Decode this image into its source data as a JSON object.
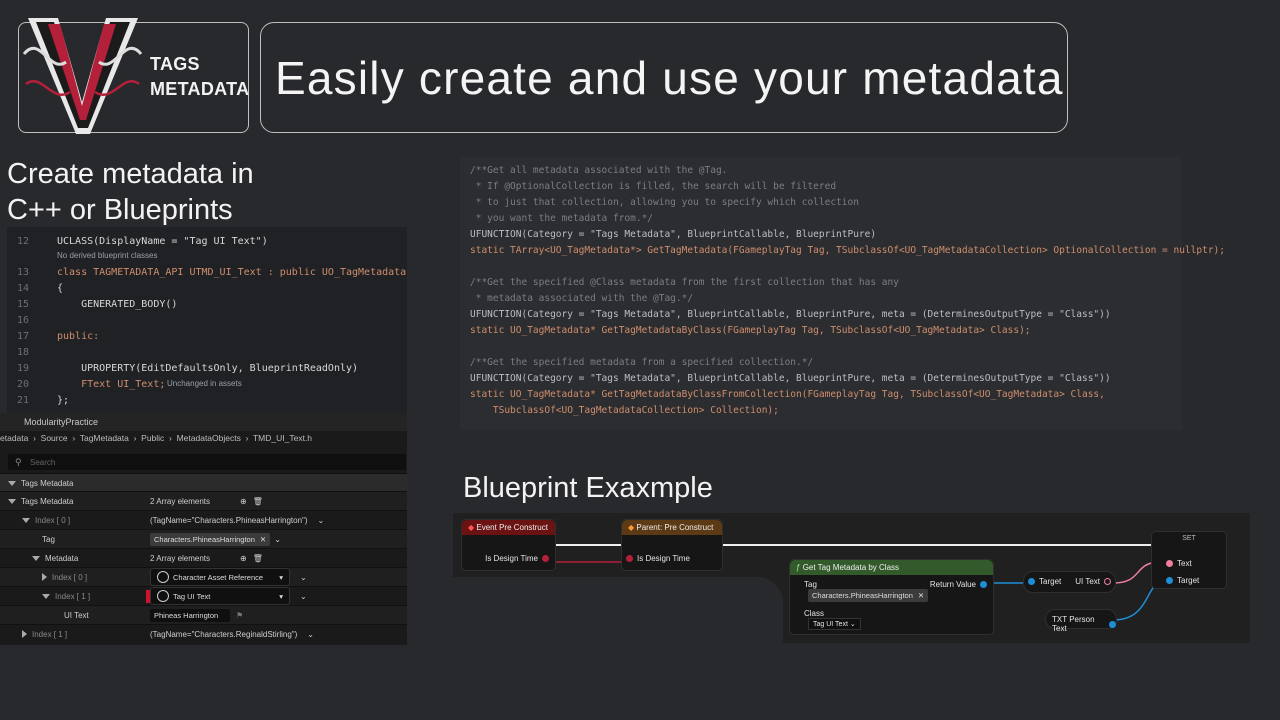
{
  "colors": {
    "background": "#28292d",
    "accent_red": "#b4203a",
    "code_bg": "#2b2d30"
  },
  "logo": {
    "line1": "TAGS",
    "line2": "METADATA",
    "icon": "tags-metadata-logo"
  },
  "title": "Easily create and use your metadata",
  "create_heading": {
    "line1": "Create metadata in",
    "line2": "C++ or Blueprints"
  },
  "ide": {
    "lines": [
      {
        "no": "12",
        "text": "UCLASS(DisplayName = \"Tag UI Text\")"
      },
      {
        "no": "13",
        "text": "class TAGMETADATA_API UTMD_UI_Text : public UO_TagMetadata"
      },
      {
        "no": "14",
        "text": "{"
      },
      {
        "no": "15",
        "text": "    GENERATED_BODY()"
      },
      {
        "no": "16",
        "text": ""
      },
      {
        "no": "17",
        "text": "public:"
      },
      {
        "no": "18",
        "text": ""
      },
      {
        "no": "19",
        "text": "    UPROPERTY(EditDefaultsOnly, BlueprintReadOnly)"
      },
      {
        "no": "20",
        "text": "    FText UI_Text;"
      },
      {
        "no": "21",
        "text": "};"
      }
    ],
    "hint_derived": "No derived blueprint classes",
    "hint_unchanged": "Unchanged in assets"
  },
  "details": {
    "tab": "ModularityPractice",
    "breadcrumb": [
      "etadata",
      "Source",
      "TagMetadata",
      "Public",
      "MetadataObjects",
      "TMD_UI_Text.h"
    ],
    "search_placeholder": "Search",
    "rows": {
      "section": "Tags Metadata",
      "tags_metadata": "Tags Metadata",
      "tags_metadata_value": "2 Array elements",
      "index0": "Index [ 0 ]",
      "index0_value": "(TagName=\"Characters.PhineasHarrington\")",
      "tag": "Tag",
      "tag_value": "Characters.PhineasHarrington",
      "metadata": "Metadata",
      "metadata_value": "2 Array elements",
      "meta_index0": "Index [ 0 ]",
      "meta_index0_value": "Character Asset Reference",
      "meta_index1": "Index [ 1 ]",
      "meta_index1_value": "Tag UI Text",
      "ui_text": "UI Text",
      "ui_text_value": "Phineas Harrington",
      "index1": "Index [ 1 ]",
      "index1_value": "(TagName=\"Characters.ReginaldStirling\")"
    }
  },
  "code2": {
    "lines": [
      "/**Get all metadata associated with the @Tag.",
      " * If @OptionalCollection is filled, the search will be filtered",
      " * to just that collection, allowing you to specify which collection",
      " * you want the metadata from.*/",
      "UFUNCTION(Category = \"Tags Metadata\", BlueprintCallable, BlueprintPure)",
      "static TArray<UO_TagMetadata*> GetTagMetadata(FGameplayTag Tag, TSubclassOf<UO_TagMetadataCollection> OptionalCollection = nullptr);",
      "",
      "/**Get the specified @Class metadata from the first collection that has any",
      " * metadata associated with the @Tag.*/",
      "UFUNCTION(Category = \"Tags Metadata\", BlueprintCallable, BlueprintPure, meta = (DeterminesOutputType = \"Class\"))",
      "static UO_TagMetadata* GetTagMetadataByClass(FGameplayTag Tag, TSubclassOf<UO_TagMetadata> Class);",
      "",
      "/**Get the specified metadata from a specified collection.*/",
      "UFUNCTION(Category = \"Tags Metadata\", BlueprintCallable, BlueprintPure, meta = (DeterminesOutputType = \"Class\"))",
      "static UO_TagMetadata* GetTagMetadataByClassFromCollection(FGameplayTag Tag, TSubclassOf<UO_TagMetadata> Class,",
      "    TSubclassOf<UO_TagMetadataCollection> Collection);"
    ]
  },
  "bp_heading": "Blueprint Exaxmple",
  "blueprint": {
    "event_node": "Event Pre Construct",
    "is_design_time": "Is Design Time",
    "parent_node": "Parent: Pre Construct",
    "parent_design_time": "Is Design Time",
    "get_node": "Get Tag Metadata by Class",
    "get_tag_label": "Tag",
    "get_tag_value": "Characters.PhineasHarrington",
    "get_class_label": "Class",
    "get_class_value": "Tag UI Text",
    "return_value": "Return Value",
    "cast_target": "Target",
    "cast_ui_text": "UI Text",
    "set_title": "SET",
    "set_text": "Text",
    "set_target": "Target",
    "txt_node": "TXT Person Text"
  }
}
